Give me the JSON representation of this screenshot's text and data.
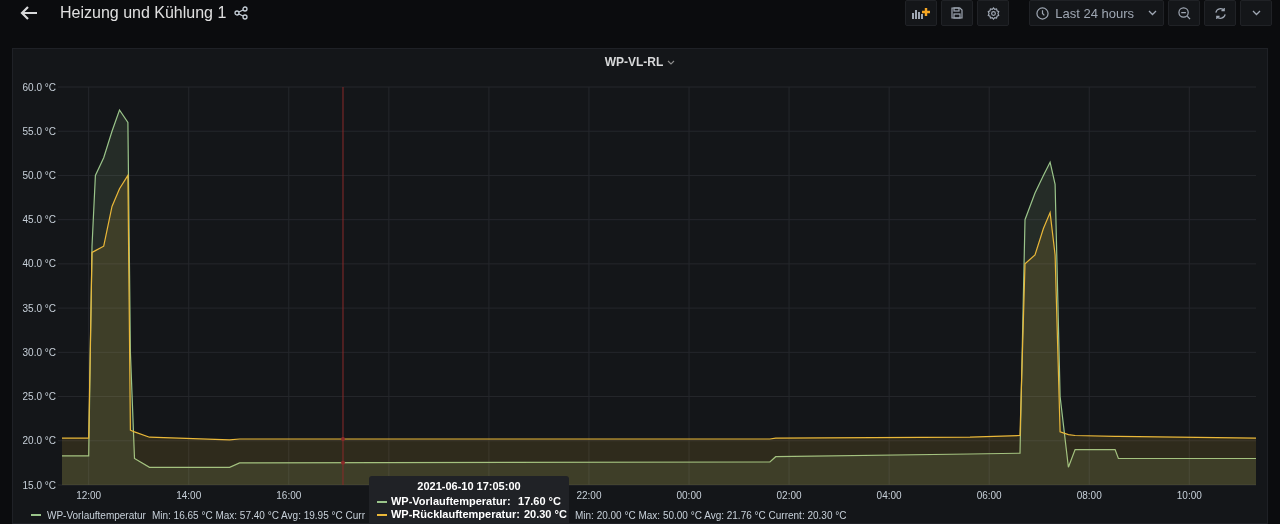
{
  "topbar": {
    "title": "Heizung und Kühlung 1",
    "time_range": "Last 24 hours"
  },
  "panel": {
    "title": "WP-VL-RL",
    "chart_data": {
      "type": "area",
      "x": [
        "2021-06-10 11:28",
        "2021-06-10 12:00",
        "2021-06-10 12:04",
        "2021-06-10 12:08",
        "2021-06-10 12:18",
        "2021-06-10 12:28",
        "2021-06-10 12:37",
        "2021-06-10 12:47",
        "2021-06-10 12:50",
        "2021-06-10 12:55",
        "2021-06-10 13:13",
        "2021-06-10 14:49",
        "2021-06-10 15:01",
        "2021-06-11 01:37",
        "2021-06-11 01:44",
        "2021-06-11 05:37",
        "2021-06-11 06:37",
        "2021-06-11 06:43",
        "2021-06-11 06:55",
        "2021-06-11 07:05",
        "2021-06-11 07:13",
        "2021-06-11 07:19",
        "2021-06-11 07:25",
        "2021-06-11 07:35",
        "2021-06-11 07:43",
        "2021-06-11 08:31",
        "2021-06-11 08:35",
        "2021-06-11 11:20"
      ],
      "series": [
        {
          "name": "WP-Vorlauftemperatur",
          "color": "#9ac48a",
          "values": [
            18.3,
            18.3,
            42,
            50,
            52,
            55,
            57.4,
            56,
            30,
            18,
            17,
            17,
            17.5,
            17.6,
            18.2,
            18.5,
            18.6,
            45,
            48,
            50,
            51.5,
            49,
            25,
            17,
            19,
            19,
            18,
            18
          ]
        },
        {
          "name": "WP-Rücklauftemperatur",
          "color": "#eab839",
          "values": [
            20.3,
            20.3,
            41.3,
            41.5,
            42,
            46.5,
            48.5,
            50,
            21.2,
            21,
            20.4,
            20.1,
            20.2,
            20.2,
            20.3,
            20.4,
            20.6,
            40,
            41,
            44,
            45.8,
            41,
            21,
            20.7,
            20.6,
            20.5,
            20.5,
            20.3
          ]
        }
      ],
      "xlim": [
        "2021-06-10 11:28",
        "2021-06-11 11:20"
      ],
      "ylim": [
        15,
        60
      ],
      "xticks": [
        {
          "value": "2021-06-10 12:00",
          "label": "12:00"
        },
        {
          "value": "2021-06-10 14:00",
          "label": "14:00"
        },
        {
          "value": "2021-06-10 16:00",
          "label": "16:00"
        },
        {
          "value": "2021-06-10 22:00",
          "label": "22:00"
        },
        {
          "value": "2021-06-11 00:00",
          "label": "00:00"
        },
        {
          "value": "2021-06-11 02:00",
          "label": "02:00"
        },
        {
          "value": "2021-06-11 04:00",
          "label": "04:00"
        },
        {
          "value": "2021-06-11 06:00",
          "label": "06:00"
        },
        {
          "value": "2021-06-11 08:00",
          "label": "08:00"
        },
        {
          "value": "2021-06-11 10:00",
          "label": "10:00"
        }
      ],
      "yticks": [
        {
          "value": 15,
          "label": "15.0 °C"
        },
        {
          "value": 20,
          "label": "20.0 °C"
        },
        {
          "value": 25,
          "label": "25.0 °C"
        },
        {
          "value": 30,
          "label": "30.0 °C"
        },
        {
          "value": 35,
          "label": "35.0 °C"
        },
        {
          "value": 40,
          "label": "40.0 °C"
        },
        {
          "value": 45,
          "label": "45.0 °C"
        },
        {
          "value": 50,
          "label": "50.0 °C"
        },
        {
          "value": 55,
          "label": "55.0 °C"
        },
        {
          "value": 60,
          "label": "60.0 °C"
        }
      ],
      "stacked": false,
      "grid": true,
      "ref_lines": [
        {
          "axis": "x",
          "value": "2021-06-10 17:05",
          "color": "#8b2a2a"
        }
      ]
    },
    "legend": [
      {
        "stats": "Min: 16.65 °C  Max: 57.40 °C  Avg: 19.95 °C  Curr"
      },
      {
        "stats": "Min: 20.00 °C  Max: 50.00 °C  Avg: 21.76 °C  Current: 20.30 °C"
      }
    ],
    "tooltip": {
      "time": "2021-06-10 17:05:00",
      "separator": ":",
      "rows": [
        {
          "value": "17.60 °C"
        },
        {
          "value": "20.30 °C"
        }
      ]
    }
  }
}
